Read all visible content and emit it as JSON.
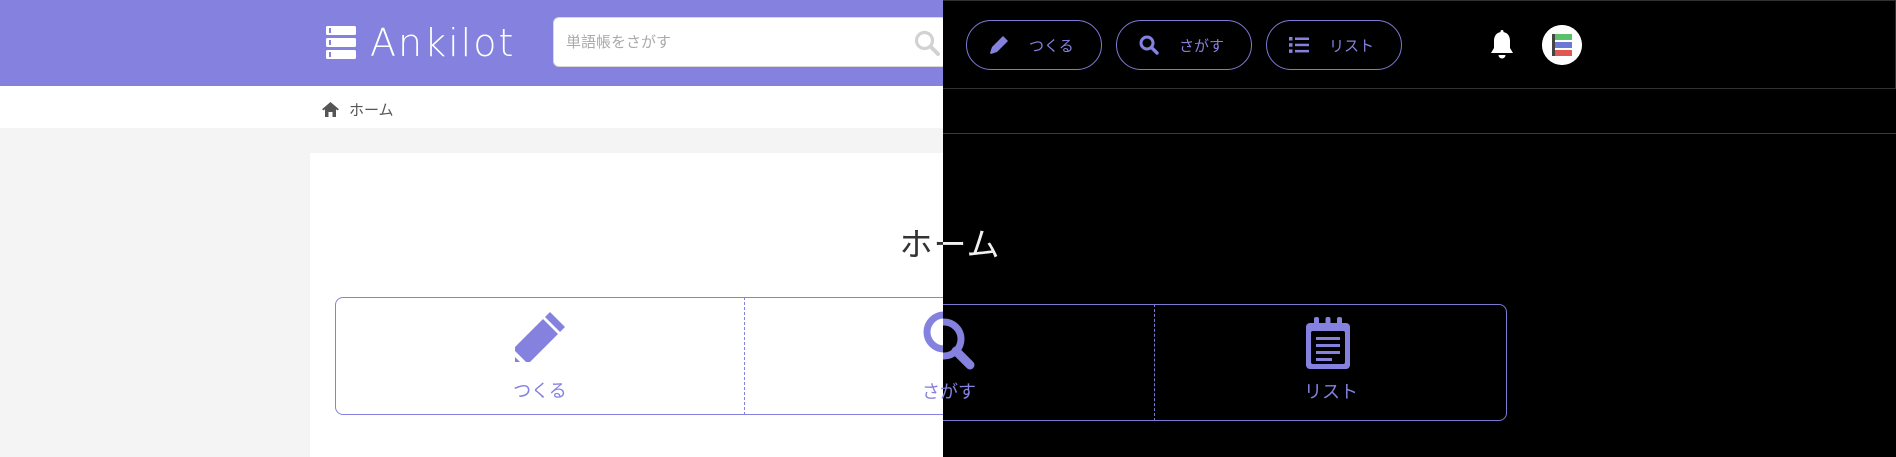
{
  "header": {
    "logo_text": "Ankilot",
    "search": {
      "placeholder": "単語帳をさがす"
    },
    "nav": [
      {
        "label": "つくる",
        "icon": "pen-icon"
      },
      {
        "label": "さがす",
        "icon": "search-icon"
      },
      {
        "label": "リスト",
        "icon": "list-icon"
      }
    ],
    "notification_icon": "bell-icon",
    "avatar_icon": "avatar"
  },
  "breadcrumb": {
    "home_label": "ホーム"
  },
  "main": {
    "title": "ホーム",
    "tiles": [
      {
        "label": "つくる",
        "icon": "pencil-icon"
      },
      {
        "label": "さがす",
        "icon": "magnifier-icon"
      },
      {
        "label": "リスト",
        "icon": "notepad-icon"
      }
    ]
  },
  "colors": {
    "accent": "#8482de",
    "header_bg": "#8482de",
    "dark_bg": "#000000",
    "page_bg": "#f4f4f4"
  }
}
